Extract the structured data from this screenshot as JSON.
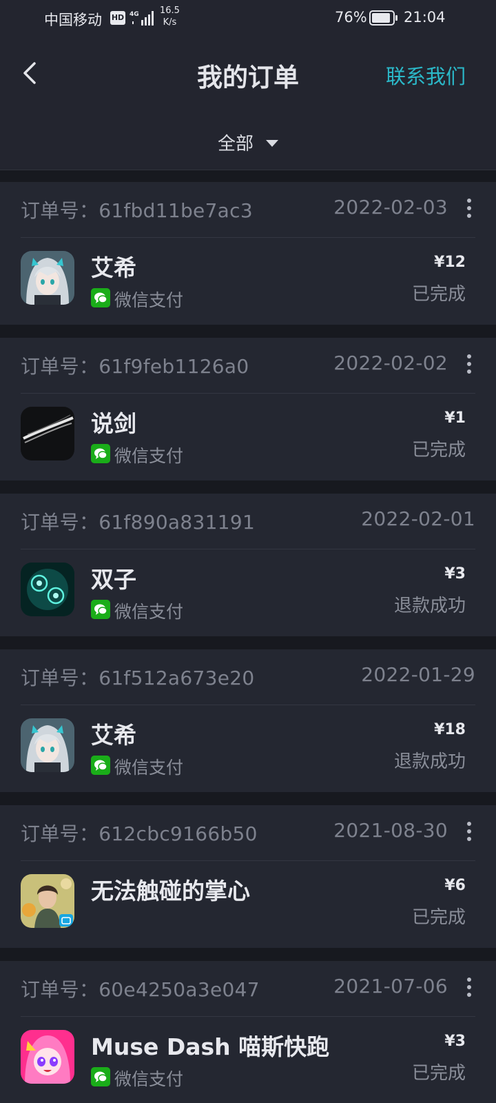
{
  "status_bar": {
    "carrier": "中国移动",
    "hd": "HD",
    "speed_value": "16.5",
    "speed_unit": "K/s",
    "battery": "76%",
    "time": "21:04"
  },
  "header": {
    "title": "我的订单",
    "contact": "联系我们",
    "filter": "全部"
  },
  "colors": {
    "accent": "#2bb8c8",
    "wechat": "#1aad19"
  },
  "order_label": "订单号：",
  "orders": [
    {
      "no": "61fbd11be7ac3",
      "date": "2022-02-03",
      "game": "艾希",
      "pay": "微信支付",
      "price": "¥12",
      "status": "已完成",
      "has_menu": true
    },
    {
      "no": "61f9feb1126a0",
      "date": "2022-02-02",
      "game": "说剑",
      "pay": "微信支付",
      "price": "¥1",
      "status": "已完成",
      "has_menu": true
    },
    {
      "no": "61f890a831191",
      "date": "2022-02-01",
      "game": "双子",
      "pay": "微信支付",
      "price": "¥3",
      "status": "退款成功",
      "has_menu": false
    },
    {
      "no": "61f512a673e20",
      "date": "2022-01-29",
      "game": "艾希",
      "pay": "微信支付",
      "price": "¥18",
      "status": "退款成功",
      "has_menu": false
    },
    {
      "no": "612cbc9166b50",
      "date": "2021-08-30",
      "game": "无法触碰的掌心",
      "pay": "",
      "price": "¥6",
      "status": "已完成",
      "has_menu": true
    },
    {
      "no": "60e4250a3e047",
      "date": "2021-07-06",
      "game": "Muse Dash 喵斯快跑",
      "pay": "微信支付",
      "price": "¥3",
      "status": "已完成",
      "has_menu": true
    }
  ]
}
